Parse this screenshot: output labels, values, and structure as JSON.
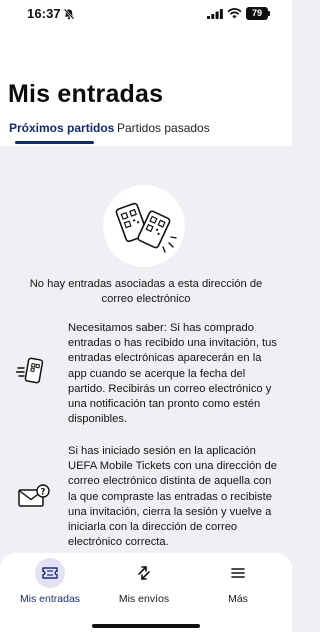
{
  "status_bar": {
    "time": "16:37",
    "battery": "79"
  },
  "page": {
    "title": "Mis entradas"
  },
  "tabs": [
    {
      "label": "Próximos partidos",
      "active": true
    },
    {
      "label": "Partidos pasados",
      "active": false
    }
  ],
  "empty_state": {
    "message": "No hay entradas asociadas a esta dirección de correo electrónico"
  },
  "info": [
    {
      "icon": "phone-qr-icon",
      "text": "Necesitamos saber: Si has comprado entradas o has recibido una invitación, tus entradas electrónicas aparecerán en la app cuando se acerque la fecha del partido. Recibirás un correo electrónico y una notificación tan pronto como estén disponibles."
    },
    {
      "icon": "mail-question-icon",
      "text": "Si has iniciado sesión en la aplicación UEFA Mobile Tickets con una dirección de correo electrónico distinta de aquella con la que compraste las entradas o recibiste una invitación, cierra la sesión y vuelve a iniciarla con la dirección de correo electrónico correcta."
    }
  ],
  "bottom_nav": [
    {
      "label": "Mis entradas",
      "icon": "ticket-icon",
      "active": true
    },
    {
      "label": "Mis envíos",
      "icon": "transfer-arrows-icon",
      "active": false
    },
    {
      "label": "Más",
      "icon": "menu-icon",
      "active": false
    }
  ],
  "colors": {
    "accent": "#0f2a6e",
    "background": "#eef0f3",
    "active_nav_bg": "#e4e1f5"
  }
}
